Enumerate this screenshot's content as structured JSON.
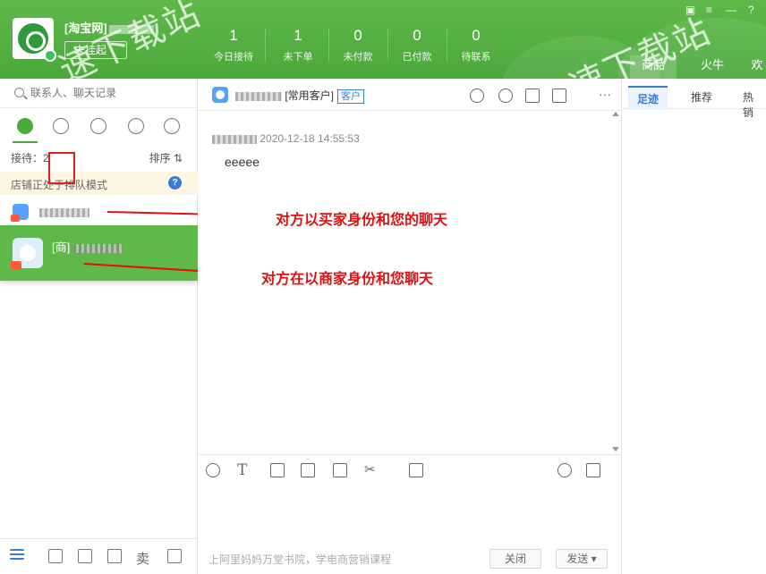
{
  "header": {
    "shop_name": "[淘宝网]",
    "status_label": "未挂起",
    "stats": [
      {
        "num": "1",
        "label": "今日接待"
      },
      {
        "num": "1",
        "label": "未下单"
      },
      {
        "num": "0",
        "label": "未付款"
      },
      {
        "num": "0",
        "label": "已付款"
      },
      {
        "num": "0",
        "label": "待联系"
      }
    ],
    "tabs": [
      "商品",
      "火牛",
      "欢"
    ],
    "watermark": "速下载站"
  },
  "sidebar": {
    "search_placeholder": "联系人、聊天记录",
    "queue_label": "接待：2",
    "sort_label": "排序 ⇅",
    "queue_notice": "店铺正处于排队模式",
    "help": "?",
    "contacts": [
      {
        "prefix": ""
      },
      {
        "prefix": "[商]"
      }
    ],
    "footer_sell": "卖"
  },
  "chat": {
    "customer_tag": "[常用客户]",
    "badge": "客户",
    "timestamp": "2020-12-18 14:55:53",
    "message": "eeeee",
    "annotation_buyer": "对方以买家身份和您的聊天",
    "annotation_seller": "对方在以商家身份和您聊天",
    "footer_tip": "上阿里妈妈万堂书院，学电商营销课程",
    "close_button": "关闭",
    "send_button": "发送 ▾"
  },
  "right": {
    "tabs": [
      "足迹",
      "推荐",
      "热销"
    ]
  }
}
